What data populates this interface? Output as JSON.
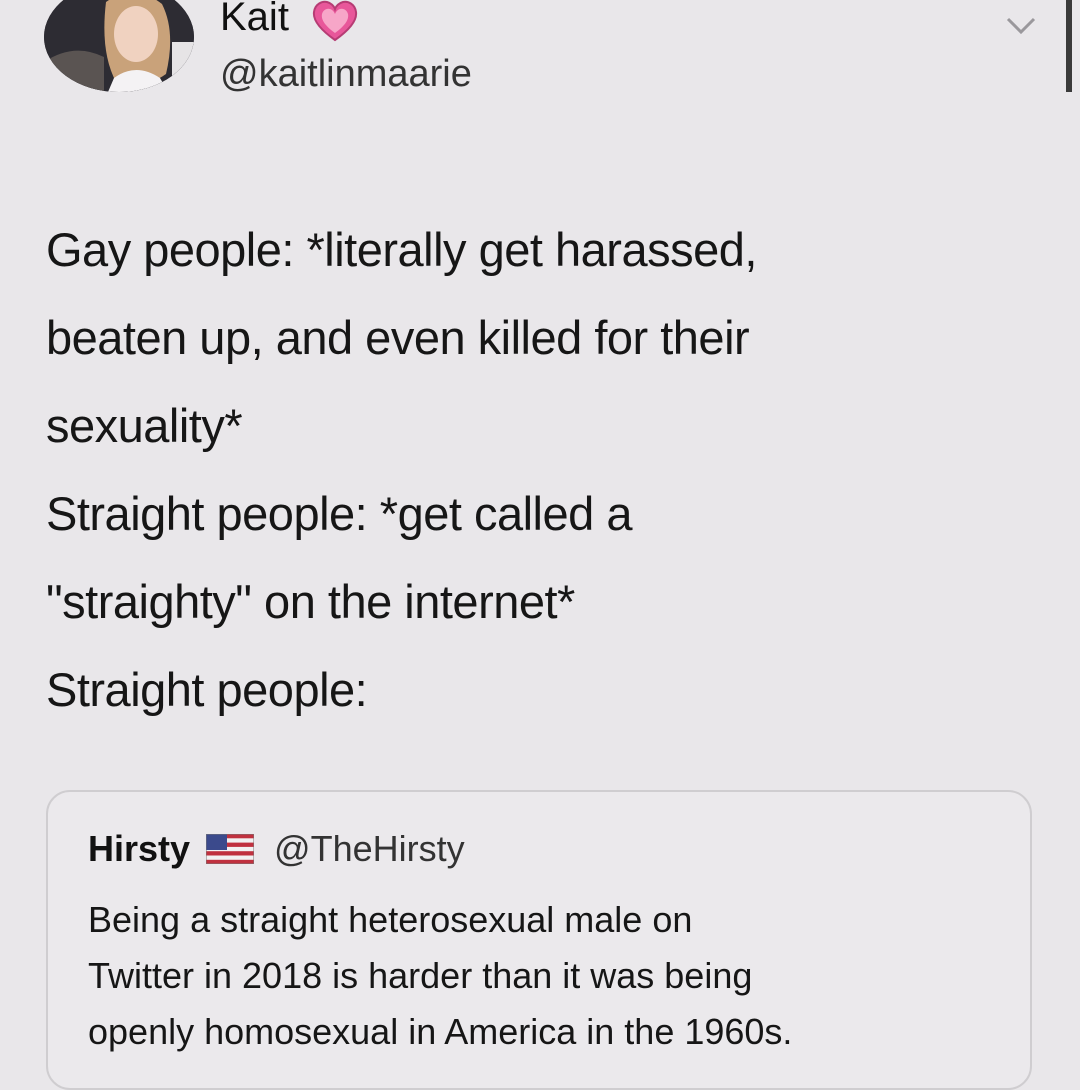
{
  "tweet": {
    "author_name": "Kait",
    "author_handle": "@kaitlinmaarie",
    "name_badge_icon": "pink-heart-icon",
    "menu_icon": "chevron-down-icon",
    "text_lines": [
      "Gay people: *literally get harassed,",
      "beaten up, and even killed for their",
      "sexuality*",
      "Straight people: *get called a",
      "\"straighty\" on the internet*",
      "Straight people:"
    ]
  },
  "quote": {
    "author_name": "Hirsty",
    "author_handle": "@TheHirsty",
    "name_badge_icon": "us-flag-icon",
    "text_lines": [
      "Being a straight heterosexual male on",
      "Twitter in 2018 is harder than it was being",
      "openly homosexual in America in the 1960s."
    ]
  },
  "colors": {
    "background": "#e9e7ea",
    "text": "#161616",
    "heart": "#e8579a",
    "card_border": "#cfcdd0"
  }
}
